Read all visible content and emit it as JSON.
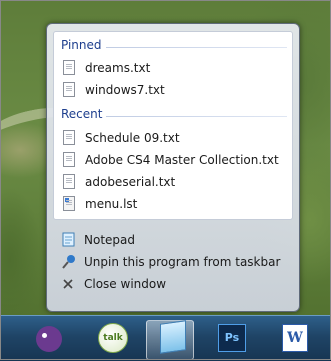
{
  "jumplist": {
    "pinned": {
      "heading": "Pinned",
      "items": [
        {
          "label": "dreams.txt",
          "icon": "text-file-icon"
        },
        {
          "label": "windows7.txt",
          "icon": "text-file-icon"
        }
      ]
    },
    "recent": {
      "heading": "Recent",
      "items": [
        {
          "label": "Schedule 09.txt",
          "icon": "text-file-icon"
        },
        {
          "label": "Adobe CS4 Master Collection.txt",
          "icon": "text-file-icon"
        },
        {
          "label": "adobeserial.txt",
          "icon": "text-file-icon"
        },
        {
          "label": "menu.lst",
          "icon": "list-file-icon"
        }
      ]
    },
    "tasks": [
      {
        "label": "Notepad",
        "icon": "notepad-icon"
      },
      {
        "label": "Unpin this program from taskbar",
        "icon": "unpin-icon"
      },
      {
        "label": "Close window",
        "icon": "close-icon"
      }
    ]
  },
  "taskbar": {
    "talk_label": "talk",
    "ps_label": "Ps",
    "word_label": "W"
  }
}
